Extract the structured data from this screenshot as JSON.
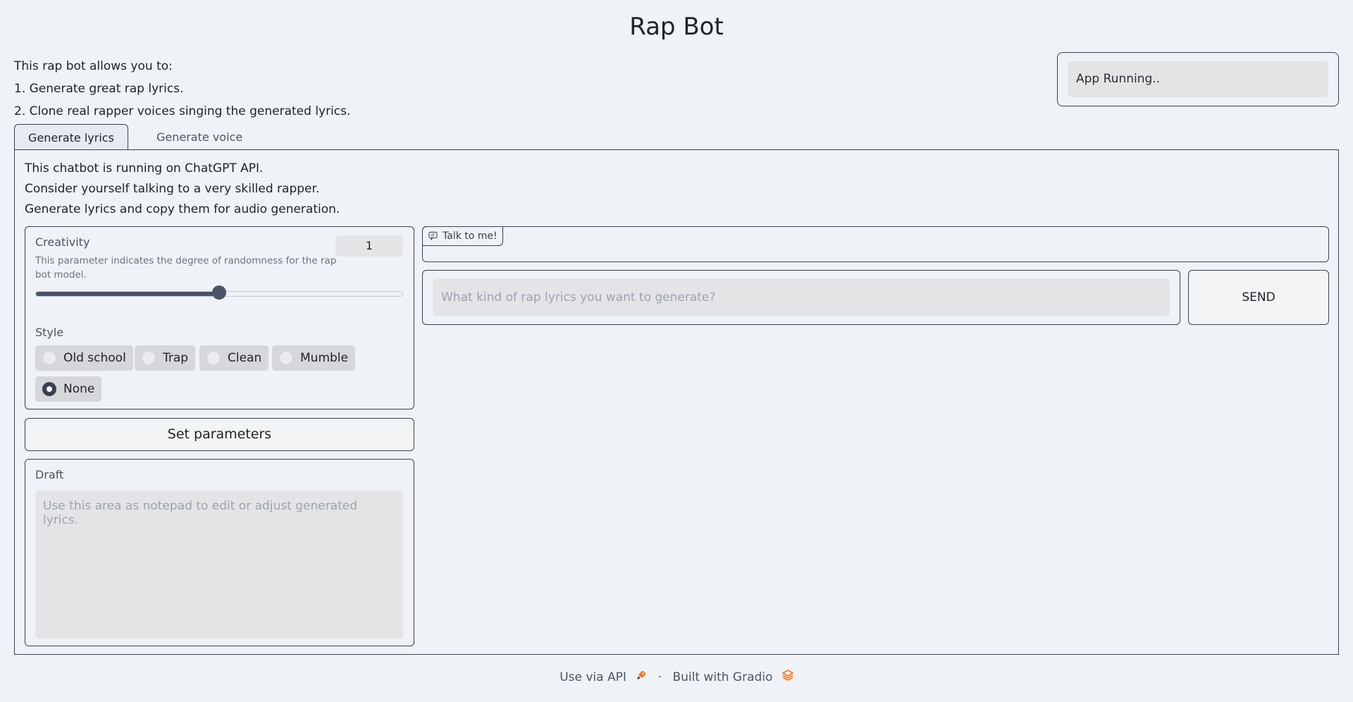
{
  "app": {
    "title": "Rap Bot"
  },
  "intro": {
    "lines": [
      "This rap bot allows you to:",
      "1. Generate great rap lyrics.",
      "2. Clone real rapper voices singing the generated lyrics."
    ]
  },
  "status": {
    "value": "App Running.."
  },
  "tabs": [
    {
      "label": "Generate lyrics",
      "active": true
    },
    {
      "label": "Generate voice",
      "active": false
    }
  ],
  "lyrics_tab": {
    "description": [
      "This chatbot is running on ChatGPT API.",
      "Consider yourself talking to a very skilled rapper.",
      "Generate lyrics and copy them for audio generation."
    ],
    "creativity": {
      "label": "Creativity",
      "info": "This parameter indicates the degree of randomness for the rap bot model.",
      "value": "1",
      "slider_fraction": 0.5
    },
    "style": {
      "label": "Style",
      "options": [
        "Old school",
        "Trap",
        "Clean",
        "Mumble",
        "None"
      ],
      "selected": "None"
    },
    "set_parameters_label": "Set parameters",
    "draft": {
      "label": "Draft",
      "placeholder": "Use this area as notepad to edit or adjust generated lyrics."
    },
    "chatbot": {
      "badge": "Talk to me!"
    },
    "message": {
      "placeholder": "What kind of rap lyrics you want to generate?"
    },
    "send_label": "SEND"
  },
  "footer": {
    "api_label": "Use via API",
    "separator": "·",
    "built_label": "Built with Gradio"
  },
  "colors": {
    "background": "#eff2f7",
    "border": "#3b4351",
    "input_bg": "#e4e4e7",
    "accent": "#4a5568",
    "gradio_orange": "#f97316"
  }
}
